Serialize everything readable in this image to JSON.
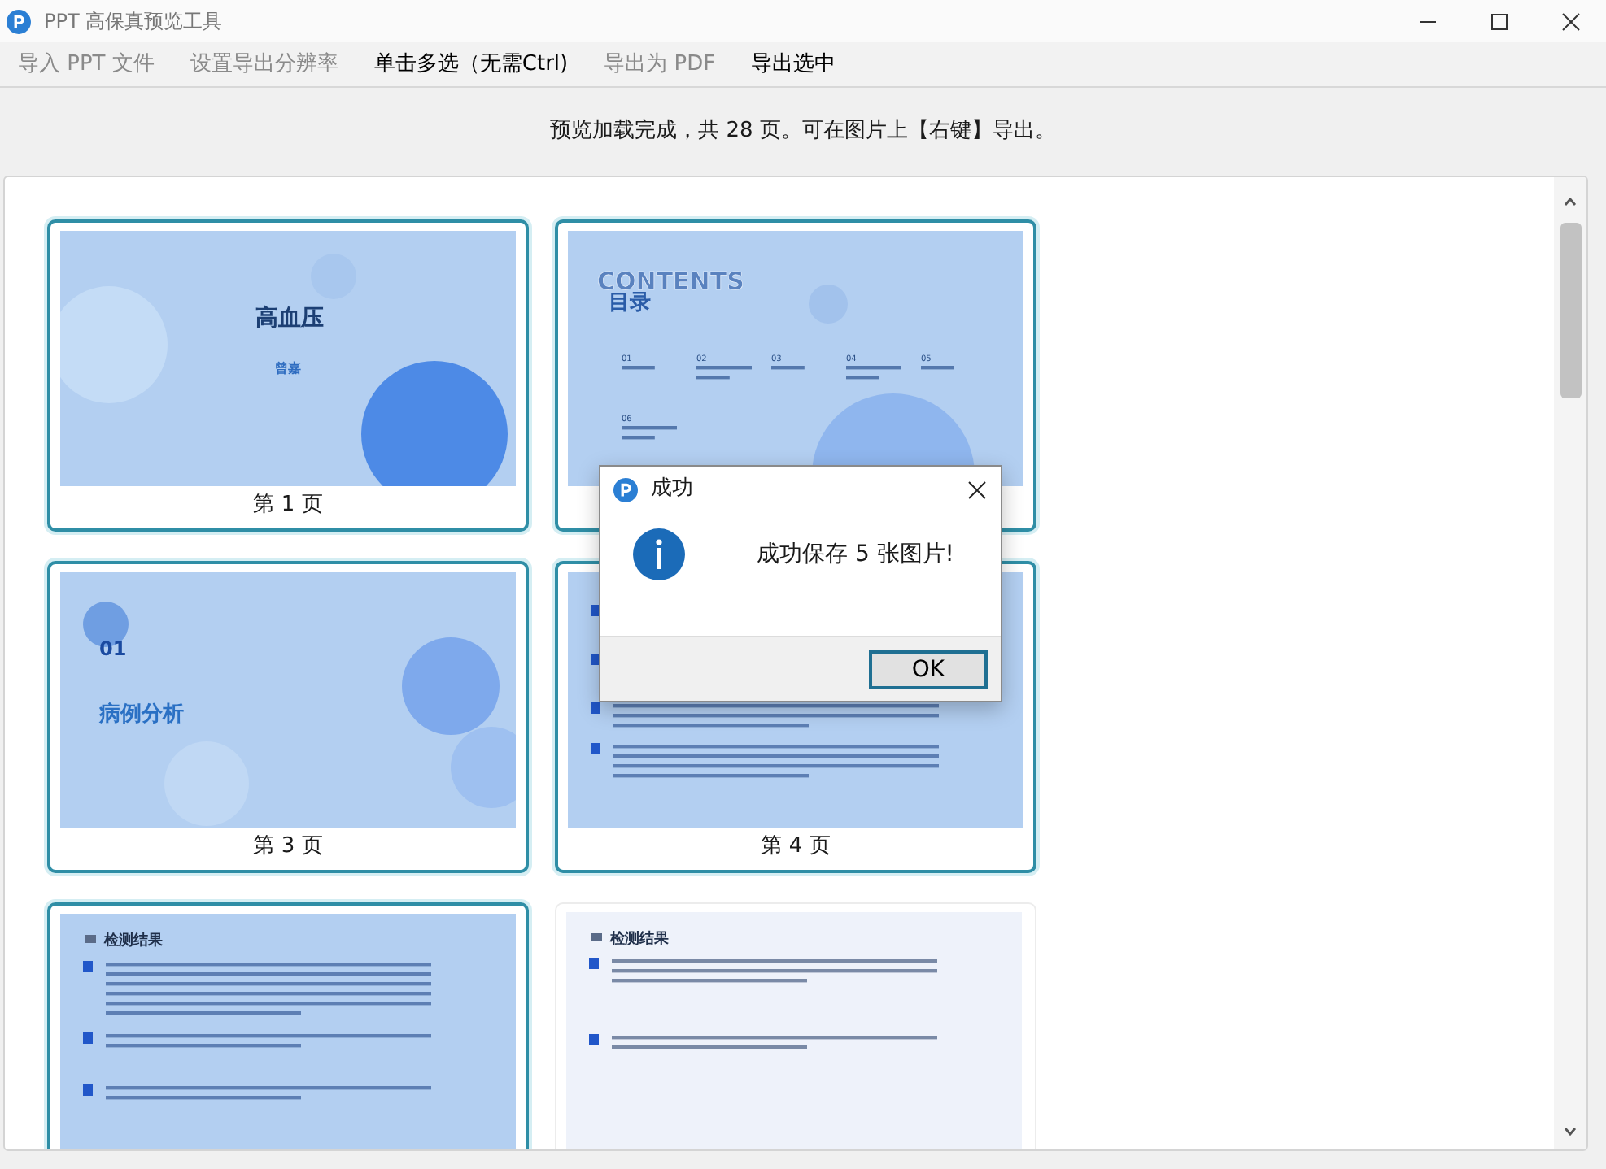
{
  "window": {
    "title": "PPT 高保真预览工具"
  },
  "menu": [
    {
      "label": "导入 PPT 文件",
      "disabled": true
    },
    {
      "label": "设置导出分辨率",
      "disabled": true
    },
    {
      "label": "单击多选（无需Ctrl)",
      "disabled": false
    },
    {
      "label": "导出为 PDF",
      "disabled": true
    },
    {
      "label": "导出选中",
      "disabled": false
    }
  ],
  "status": "预览加载完成，共 28 页。可在图片上【右键】导出。",
  "slides": [
    {
      "kind": "title",
      "selected": true,
      "title": "高血压",
      "subtitle": "曾嘉",
      "label": "第 1 页"
    },
    {
      "kind": "contents",
      "selected": true,
      "heading": "CONTENTS",
      "title": "目录",
      "items": [
        "01",
        "02",
        "03",
        "04",
        "05",
        "06"
      ]
    },
    {
      "kind": "section",
      "selected": true,
      "number": "01",
      "title": "病例分析",
      "label": "第 3 页"
    },
    {
      "kind": "results",
      "selected": true,
      "label": "第 4 页"
    },
    {
      "kind": "results",
      "selected": true,
      "title": "检测结果"
    },
    {
      "kind": "plain",
      "selected": false,
      "title": "检测结果"
    }
  ],
  "dialog": {
    "title": "成功",
    "message": "成功保存 5 张图片!",
    "button": "OK"
  }
}
